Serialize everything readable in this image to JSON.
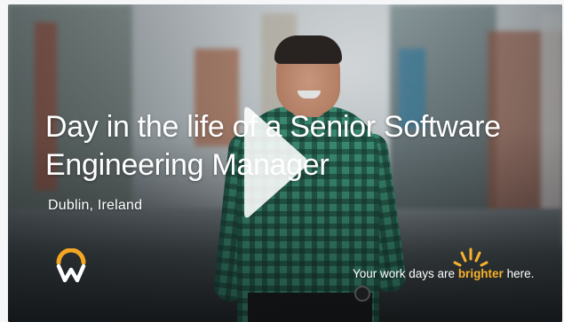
{
  "video": {
    "title": "Day in the life of a Senior Software Engineering Manager",
    "location": "Dublin, Ireland",
    "play_icon": "play-icon"
  },
  "brand": {
    "logo_icon": "workday-logo-icon",
    "tagline_prefix": "Your work days are ",
    "tagline_highlight": "brighter",
    "tagline_suffix": " here.",
    "accent_color": "#f7b22b",
    "logo_blue": "#0875e1",
    "logo_orange": "#f5a623"
  }
}
